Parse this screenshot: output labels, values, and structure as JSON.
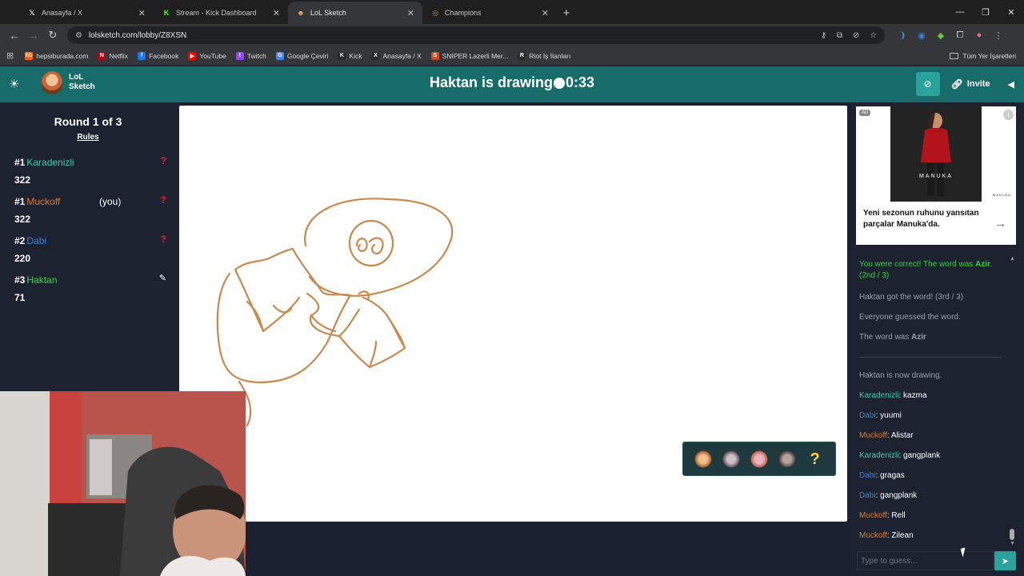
{
  "browser": {
    "tabs": [
      {
        "title": "Anasayfa / X",
        "icon": "x-logo-icon",
        "active": false
      },
      {
        "title": "Stream - Kick Dashboard",
        "icon": "kick-logo-icon",
        "active": false
      },
      {
        "title": "LoL Sketch",
        "icon": "lol-sketch-icon",
        "active": true
      },
      {
        "title": "Champions",
        "icon": "champions-icon",
        "active": false
      }
    ],
    "url": "lolsketch.com/lobby/Z8XSN",
    "bookmarks": [
      {
        "label": "hepsiburada.com",
        "icon_text": "hb",
        "color": "#ff6000"
      },
      {
        "label": "Netflix",
        "icon_text": "N",
        "color": "#b00710"
      },
      {
        "label": "Facebook",
        "icon_text": "f",
        "color": "#1877f2"
      },
      {
        "label": "YouTube",
        "icon_text": "▶",
        "color": "#ff0000"
      },
      {
        "label": "Twitch",
        "icon_text": "t",
        "color": "#9146ff"
      },
      {
        "label": "Google Çeviri",
        "icon_text": "G",
        "color": "#4285f4"
      },
      {
        "label": "Kick",
        "icon_text": "K",
        "color": "#2a2a2a"
      },
      {
        "label": "Anasayfa / X",
        "icon_text": "X",
        "color": "#2a2a2a"
      },
      {
        "label": "SNIPER Lazerli Mer...",
        "icon_text": "S",
        "color": "#d9481c"
      },
      {
        "label": "Riot İş İlanları",
        "icon_text": "R",
        "color": "#2a2a2a"
      }
    ],
    "all_bookmarks_label": "Tüm Yer İşaretleri"
  },
  "header": {
    "logo_line1": "LoL",
    "logo_line2": "Sketch",
    "drawer_text": "Haktan is drawing",
    "timer": "0:33",
    "invite_label": "Invite"
  },
  "scoreboard": {
    "round_label": "Round 1 of 3",
    "rules_label": "Rules",
    "players": [
      {
        "rank": "#1",
        "name": "Karadenizli",
        "color": "#36d2b0",
        "score": "322",
        "you": "",
        "status": "?"
      },
      {
        "rank": "#1",
        "name": "Muckoff",
        "color": "#e07b2f",
        "score": "322",
        "you": "(you)",
        "status": "?"
      },
      {
        "rank": "#2",
        "name": "Dabi",
        "color": "#3f83d8",
        "score": "220",
        "you": "",
        "status": "?"
      },
      {
        "rank": "#3",
        "name": "Haktan",
        "color": "#45d34a",
        "score": "71",
        "you": "",
        "status": "drawing"
      }
    ]
  },
  "ad": {
    "badge": "AD",
    "brand": "MANUKA",
    "text": "Yeni sezonun ruhunu yansıtan parçalar Manuka'da."
  },
  "chat": {
    "correct_prefix": "You were correct! The word was ",
    "correct_word": "Azir",
    "correct_suffix": ". (2nd / 3)",
    "sys1": "Haktan got the word! (3rd / 3)",
    "sys2": "Everyone guessed the word.",
    "sys3_prefix": "The word was ",
    "sys3_word": "Azir",
    "sys4": "Haktan is now drawing.",
    "messages": [
      {
        "name": "Karadenizli",
        "color": "#36d2b0",
        "text": "kazma"
      },
      {
        "name": "Dabi",
        "color": "#3f83d8",
        "text": "yuumi"
      },
      {
        "name": "Muckoff",
        "color": "#e07b2f",
        "text": "Alistar"
      },
      {
        "name": "Karadenizli",
        "color": "#36d2b0",
        "text": "gangplank"
      },
      {
        "name": "Dabi",
        "color": "#3f83d8",
        "text": "gragas"
      },
      {
        "name": "Dabi",
        "color": "#3f83d8",
        "text": "gangplank"
      },
      {
        "name": "Muckoff",
        "color": "#e07b2f",
        "text": "Rell"
      },
      {
        "name": "Muckoff",
        "color": "#e07b2f",
        "text": "Zilean"
      }
    ],
    "input_placeholder": "Type to guess..."
  },
  "colors": {
    "header_teal": "#176c6a",
    "accent_teal": "#2aa39c",
    "panel_bg": "#1c2230",
    "sketch_stroke": "#c9894c"
  }
}
